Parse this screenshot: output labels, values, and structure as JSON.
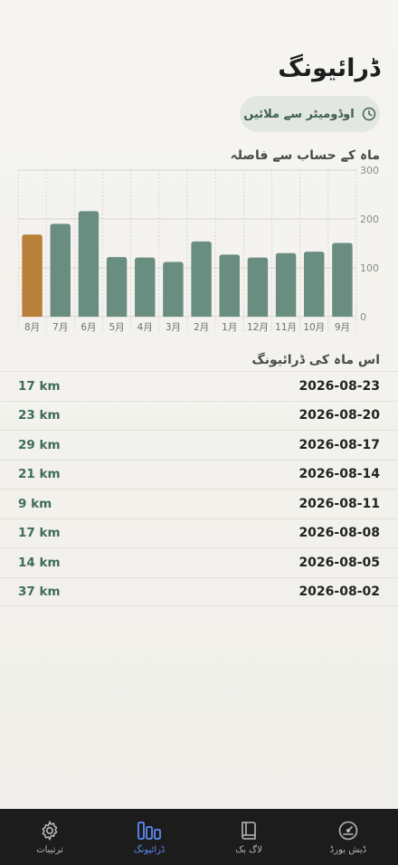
{
  "header": {
    "title": "ڈرائیونگ"
  },
  "sync": {
    "label": "اوڈومیٹر سے ملائیں"
  },
  "chart_section": {
    "title": "ماہ کے حساب سے فاصلہ"
  },
  "chart_data": {
    "type": "bar",
    "categories": [
      "8月",
      "7月",
      "6月",
      "5月",
      "4月",
      "3月",
      "2月",
      "1月",
      "12月",
      "11月",
      "10月",
      "9月"
    ],
    "values": [
      168,
      190,
      216,
      122,
      121,
      112,
      154,
      127,
      121,
      130,
      133,
      151
    ],
    "highlight_index": 0,
    "highlight_color": "#b9803a",
    "bar_color": "#6a8d82",
    "y_ticks": [
      0,
      100,
      200,
      300
    ],
    "ylim": [
      0,
      300
    ],
    "y_axis_side": "right"
  },
  "month_section": {
    "title": "اس ماہ کی ڈرائیونگ"
  },
  "entries": [
    {
      "distance": "17 km",
      "date": "2026-08-23"
    },
    {
      "distance": "23 km",
      "date": "2026-08-20"
    },
    {
      "distance": "29 km",
      "date": "2026-08-17"
    },
    {
      "distance": "21 km",
      "date": "2026-08-14"
    },
    {
      "distance": "9 km",
      "date": "2026-08-11"
    },
    {
      "distance": "17 km",
      "date": "2026-08-08"
    },
    {
      "distance": "14 km",
      "date": "2026-08-05"
    },
    {
      "distance": "37 km",
      "date": "2026-08-02"
    }
  ],
  "tabs": [
    {
      "label": "ترتیبات",
      "icon": "gear-icon"
    },
    {
      "label": "ڈرائیونگ",
      "icon": "bar-chart-icon"
    },
    {
      "label": "لاگ بک",
      "icon": "book-icon"
    },
    {
      "label": "ڈیش بورڈ",
      "icon": "gauge-icon"
    }
  ],
  "colors": {
    "accent": "#5b8cf7",
    "distance_text": "#3f6b5c"
  }
}
